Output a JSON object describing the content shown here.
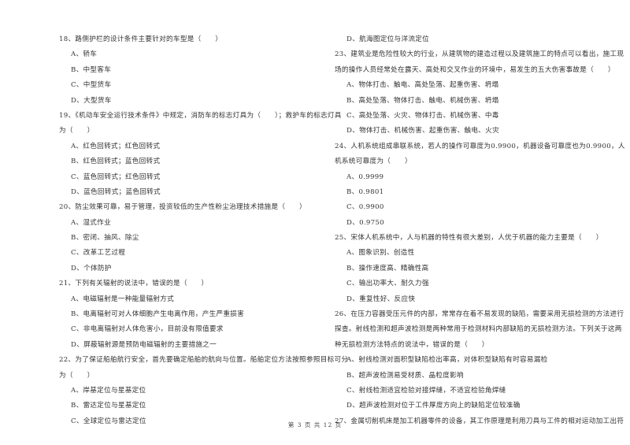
{
  "left_column": [
    {
      "type": "question",
      "text": "18、路侧护栏的设计条件主要针对的车型是（　　）"
    },
    {
      "type": "option",
      "text": "A、轿车"
    },
    {
      "type": "option",
      "text": "B、中型客车"
    },
    {
      "type": "option",
      "text": "C、中型货车"
    },
    {
      "type": "option",
      "text": "D、大型货车"
    },
    {
      "type": "question",
      "text": "19、《机动车安全运行技术条件》中规定，消防车的标志灯具为（　　）；救护车的标志灯具"
    },
    {
      "type": "continuation",
      "text": "为（　　）"
    },
    {
      "type": "option",
      "text": "A、红色回转式；红色回转式"
    },
    {
      "type": "option",
      "text": "B、红色回转式；蓝色回转式"
    },
    {
      "type": "option",
      "text": "C、蓝色回转式；红色回转式"
    },
    {
      "type": "option",
      "text": "D、蓝色回转式；蓝色回转式"
    },
    {
      "type": "question",
      "text": "20、防尘效果可靠，易于管理，投资较低的生产性粉尘治理技术措施是（　　）"
    },
    {
      "type": "option",
      "text": "A、湿式作业"
    },
    {
      "type": "option",
      "text": "B、密闭、抽风、除尘"
    },
    {
      "type": "option",
      "text": "C、改革工艺过程"
    },
    {
      "type": "option",
      "text": "D、个体防护"
    },
    {
      "type": "question",
      "text": "21、下列有关辐射的说法中，错误的是（　　）"
    },
    {
      "type": "option",
      "text": "A、电磁辐射是一种能量辐射方式"
    },
    {
      "type": "option",
      "text": "B、电离辐射可对人体细胞产生电离作用，产生严重损害"
    },
    {
      "type": "option",
      "text": "C、非电离辐射对人体危害小，目前没有限值要求"
    },
    {
      "type": "option",
      "text": "D、屏蔽辐射源是预防电磁辐射的主要措施之一"
    },
    {
      "type": "question",
      "text": "22、为了保证船舶航行安全，首先要确定船舶的航向与位置。船舶定位方法按照参照目标可分"
    },
    {
      "type": "continuation",
      "text": "为（　　）"
    },
    {
      "type": "option",
      "text": "A、岸基定位与星基定位"
    },
    {
      "type": "option",
      "text": "B、雷达定位与星基定位"
    },
    {
      "type": "option",
      "text": "C、全球定位与雷达定位"
    }
  ],
  "right_column": [
    {
      "type": "option",
      "text": "D、航海图定位与洋流定位"
    },
    {
      "type": "question",
      "text": "23、建筑业是危险性较大的行业，从建筑物的建造过程以及建筑施工的特点可以看出，施工现"
    },
    {
      "type": "continuation",
      "text": "场的操作人员经常处在露天、高处和交叉作业的环境中，易发生的五大伤害事故是（　　）"
    },
    {
      "type": "option",
      "text": "A、物体打击、触电、高处坠落、起重伤害、坍塌"
    },
    {
      "type": "option",
      "text": "B、高处坠落、物体打击、触电、机械伤害、坍塌"
    },
    {
      "type": "option",
      "text": "C、高处坠落、火灾、物体打击、机械伤害、中毒"
    },
    {
      "type": "option",
      "text": "D、物体打击、机械伤害、起重伤害、触电、火灾"
    },
    {
      "type": "question",
      "text": "24、人机系统组成串联系统，若人的操作可靠度为0.9900，机器设备可靠度也为0.9900，人"
    },
    {
      "type": "continuation",
      "text": "机系统可靠度为（　　）"
    },
    {
      "type": "option",
      "text": "A、0.9999"
    },
    {
      "type": "option",
      "text": "B、0.9801"
    },
    {
      "type": "option",
      "text": "C、0.9900"
    },
    {
      "type": "option",
      "text": "D、0.9750"
    },
    {
      "type": "question",
      "text": "25、宋体人机系统中，人与机器的特性有很大差别，人优于机器的能力主要是（　　）"
    },
    {
      "type": "option",
      "text": "A、图象识别、创造性"
    },
    {
      "type": "option",
      "text": "B、操作速度高、精确性高"
    },
    {
      "type": "option",
      "text": "C、输出功率大、耐久力强"
    },
    {
      "type": "option",
      "text": "D、重复性好、反应快"
    },
    {
      "type": "question",
      "text": "26、在压力容器受压元件的内部，常常存在着不易发现的缺陷，需要采用无损检测的方法进行"
    },
    {
      "type": "continuation",
      "text": "探查。射线检测和超声波检测是两种常用于检测材料内部缺陷的无损检测方法。下列关于这两"
    },
    {
      "type": "continuation",
      "text": "种无损检测方法特点的说法中，错误的是（　　）"
    },
    {
      "type": "option",
      "text": "A、射线检测对面积型缺陷检出率高，对体积型缺陷有时容易漏检"
    },
    {
      "type": "option",
      "text": "B、超声波检测易受材质、晶粒度影响"
    },
    {
      "type": "option",
      "text": "C、射线检测适宜检验对接焊缝，不适宜检验角焊缝"
    },
    {
      "type": "option",
      "text": "D、超声波检测对位于工件厚度方向上的缺陷定位较准确"
    },
    {
      "type": "question",
      "text": "27、金属切削机床是加工机器零件的设备，其工作原理是利用刀具与工件的相对运动加工出符"
    }
  ],
  "footer": {
    "page_label": "第 3 页 共 12 页"
  }
}
